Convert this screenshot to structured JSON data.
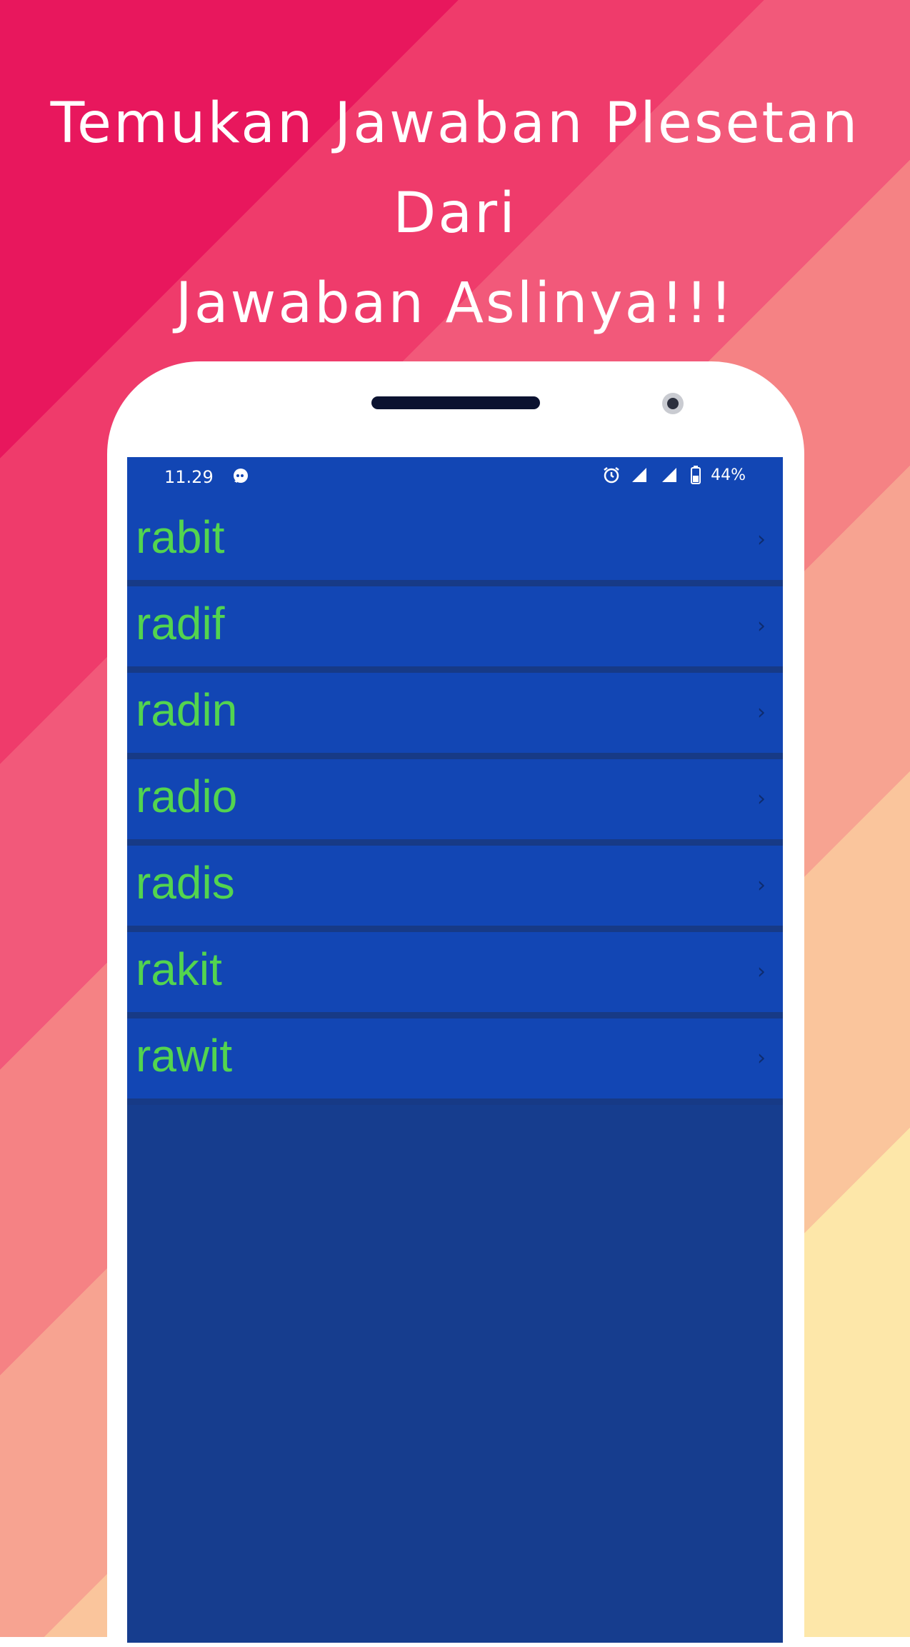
{
  "headline": {
    "line1": "Temukan Jawaban Plesetan Dari",
    "line2": "Jawaban Aslinya!!!"
  },
  "status_bar": {
    "time": "11.29",
    "battery": "44%",
    "icons": [
      "chat-notification-icon",
      "alarm-icon",
      "signal-icon",
      "signal-icon",
      "battery-icon"
    ]
  },
  "list": {
    "items": [
      {
        "label": "rabit",
        "chevron": "›"
      },
      {
        "label": "radif",
        "chevron": "›"
      },
      {
        "label": "radin",
        "chevron": "›"
      },
      {
        "label": "radio",
        "chevron": "›"
      },
      {
        "label": "radis",
        "chevron": "›"
      },
      {
        "label": "rakit",
        "chevron": "›"
      },
      {
        "label": "rawit",
        "chevron": "›"
      }
    ]
  },
  "colors": {
    "screen_bg": "#163d8e",
    "row_bg": "#1246b4",
    "row_text": "#53d44f",
    "headline_text": "#ffffff"
  }
}
